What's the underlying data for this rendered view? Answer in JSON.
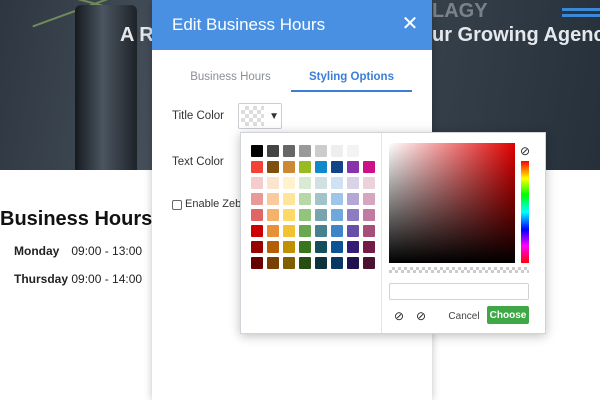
{
  "background": {
    "tagline_left": "A R",
    "tagline_right": "ur Growing Agenc",
    "top_right": "LAGY",
    "schedule_title": "Business Hours",
    "rows": [
      {
        "day": "Monday",
        "hours": "09:00 - 13:00"
      },
      {
        "day": "Thursday",
        "hours": "09:00 - 14:00"
      }
    ]
  },
  "modal": {
    "title": "Edit Business Hours",
    "close_icon": "close-icon",
    "tabs": [
      {
        "label": "Business Hours",
        "active": false
      },
      {
        "label": "Styling Options",
        "active": true
      }
    ],
    "fields": {
      "title_color_label": "Title Color",
      "text_color_label": "Text Color",
      "enable_label": "Enable Zeb"
    }
  },
  "picker": {
    "palette": [
      "#000000",
      "#444444",
      "#666666",
      "#999999",
      "#cccccc",
      "#eeeeee",
      "#f3f3f3",
      "#ffffff",
      "#f44336",
      "#7f4f0f",
      "#cc8833",
      "#99bb22",
      "#1188cc",
      "#114488",
      "#8833aa",
      "#cc1188",
      "#f4cccc",
      "#fce5cd",
      "#fff2cc",
      "#d9ead3",
      "#d0e0e3",
      "#cfe2f3",
      "#d9d2e9",
      "#ead1dc",
      "#ea9999",
      "#f9cb9c",
      "#ffe599",
      "#b6d7a8",
      "#a2c4c9",
      "#9fc5e8",
      "#b4a7d6",
      "#d5a6bd",
      "#e06666",
      "#f6b26b",
      "#ffd966",
      "#93c47d",
      "#76a5af",
      "#6fa8dc",
      "#8e7cc3",
      "#c27ba0",
      "#cc0000",
      "#e69138",
      "#f1c232",
      "#6aa84f",
      "#45818e",
      "#3d85c6",
      "#674ea7",
      "#a64d79",
      "#990000",
      "#b45f06",
      "#bf9000",
      "#38761d",
      "#134f5c",
      "#0b5394",
      "#351c75",
      "#741b47",
      "#660000",
      "#783f04",
      "#7f6000",
      "#274e13",
      "#0c343d",
      "#073763",
      "#20124d",
      "#4c1130"
    ],
    "hex_value": "",
    "hue_clear_icon": "no-color-icon",
    "cancel_label": "Cancel",
    "choose_label": "Choose",
    "accent": "#3fa846"
  }
}
